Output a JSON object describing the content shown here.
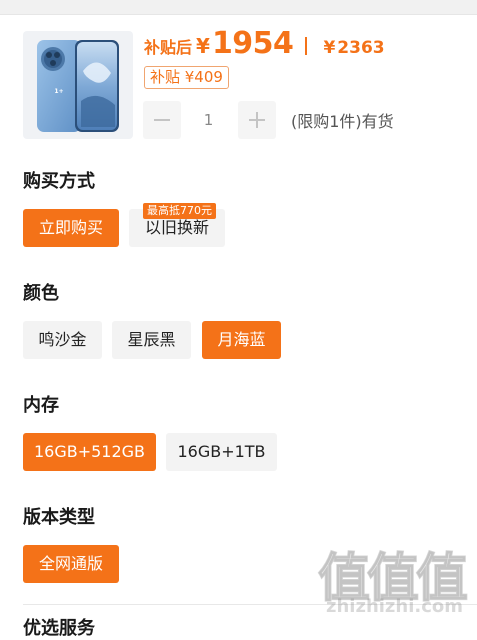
{
  "product": {
    "thumbnail_icon": "phone-image",
    "thumbnail_logo_text": "OnePlus",
    "subsidized_label": "补贴后",
    "currency": "¥",
    "subsidized_price": "1954",
    "original_currency": "¥",
    "original_price": "2363",
    "subsidy_tag": "补贴 ¥409",
    "accent_color": "#f47218"
  },
  "quantity": {
    "decrement_icon": "minus-icon",
    "increment_icon": "plus-icon",
    "value": "1",
    "stock_text": "(限购1件)有货"
  },
  "purchase_method": {
    "title": "购买方式",
    "options": [
      "立即购买",
      "以旧换新"
    ],
    "selected": "立即购买",
    "tradein_badge": "最高抵770元"
  },
  "color": {
    "title": "颜色",
    "options": [
      "鸣沙金",
      "星辰黑",
      "月海蓝"
    ],
    "selected": "月海蓝"
  },
  "storage": {
    "title": "内存",
    "options": [
      "16GB+512GB",
      "16GB+1TB"
    ],
    "selected": "16GB+512GB"
  },
  "version": {
    "title": "版本类型",
    "options": [
      "全网通版"
    ],
    "selected": "全网通版"
  },
  "next_section": {
    "title": "优选服务"
  },
  "watermark": {
    "chars": "值值值",
    "url": "zhizhizhi.com"
  }
}
